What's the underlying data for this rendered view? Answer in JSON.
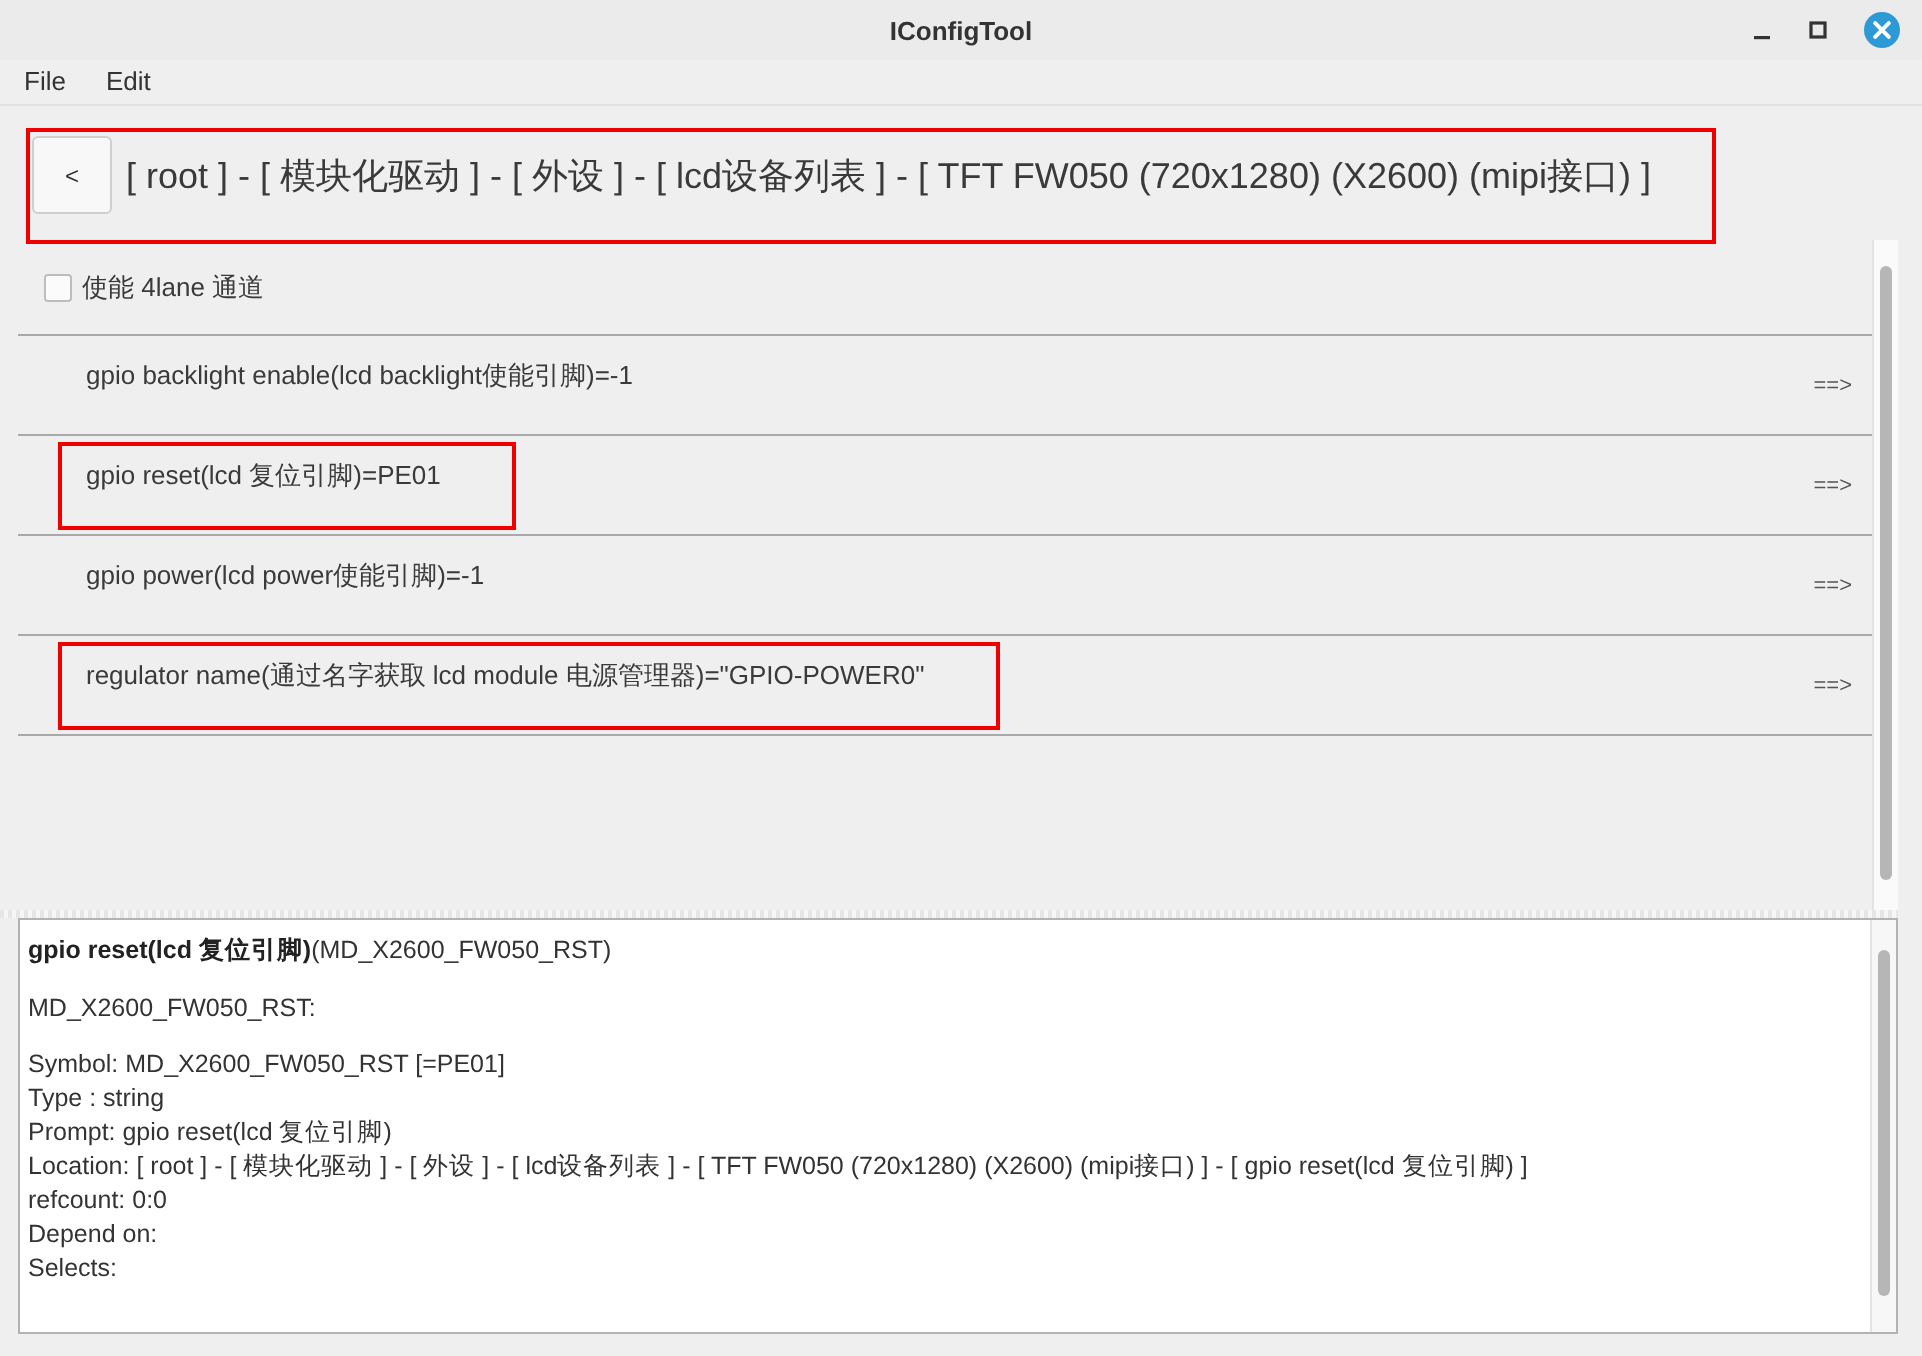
{
  "window": {
    "title": "IConfigTool"
  },
  "menu": [
    "File",
    "Edit"
  ],
  "breadcrumb": {
    "back": "<",
    "path": "[ root ] - [ 模块化驱动 ] - [ 外设 ] - [ lcd设备列表 ] - [ TFT FW050 (720x1280) (X2600) (mipi接口) ]",
    "highlighted": true
  },
  "options": [
    {
      "kind": "checkbox",
      "label": "使能 4lane 通道",
      "checked": false,
      "highlighted": false
    },
    {
      "kind": "entry",
      "label": "gpio backlight enable(lcd backlight使能引脚)=-1",
      "arrow": "==>",
      "highlighted": false
    },
    {
      "kind": "entry",
      "label": "gpio reset(lcd 复位引脚)=PE01",
      "arrow": "==>",
      "highlighted": true
    },
    {
      "kind": "entry",
      "label": "gpio power(lcd power使能引脚)=-1",
      "arrow": "==>",
      "highlighted": false
    },
    {
      "kind": "entry",
      "label": "regulator name(通过名字获取 lcd module 电源管理器)=\"GPIO-POWER0\"",
      "arrow": "==>",
      "highlighted": true
    }
  ],
  "details": {
    "heading": "**gpio reset(lcd 复位引脚)**(MD_X2600_FW050_RST)",
    "symbol": "MD_X2600_FW050_RST:",
    "lines": [
      "Symbol: MD_X2600_FW050_RST [=PE01]",
      "Type : string",
      "Prompt: gpio reset(lcd 复位引脚)",
      "Location: [ root ] - [ 模块化驱动 ] - [ 外设 ] - [ lcd设备列表 ] - [ TFT FW050 (720x1280) (X2600) (mipi接口) ] - [ gpio reset(lcd 复位引脚) ]",
      "refcount: 0:0",
      "Depend on:",
      "Selects:"
    ]
  }
}
